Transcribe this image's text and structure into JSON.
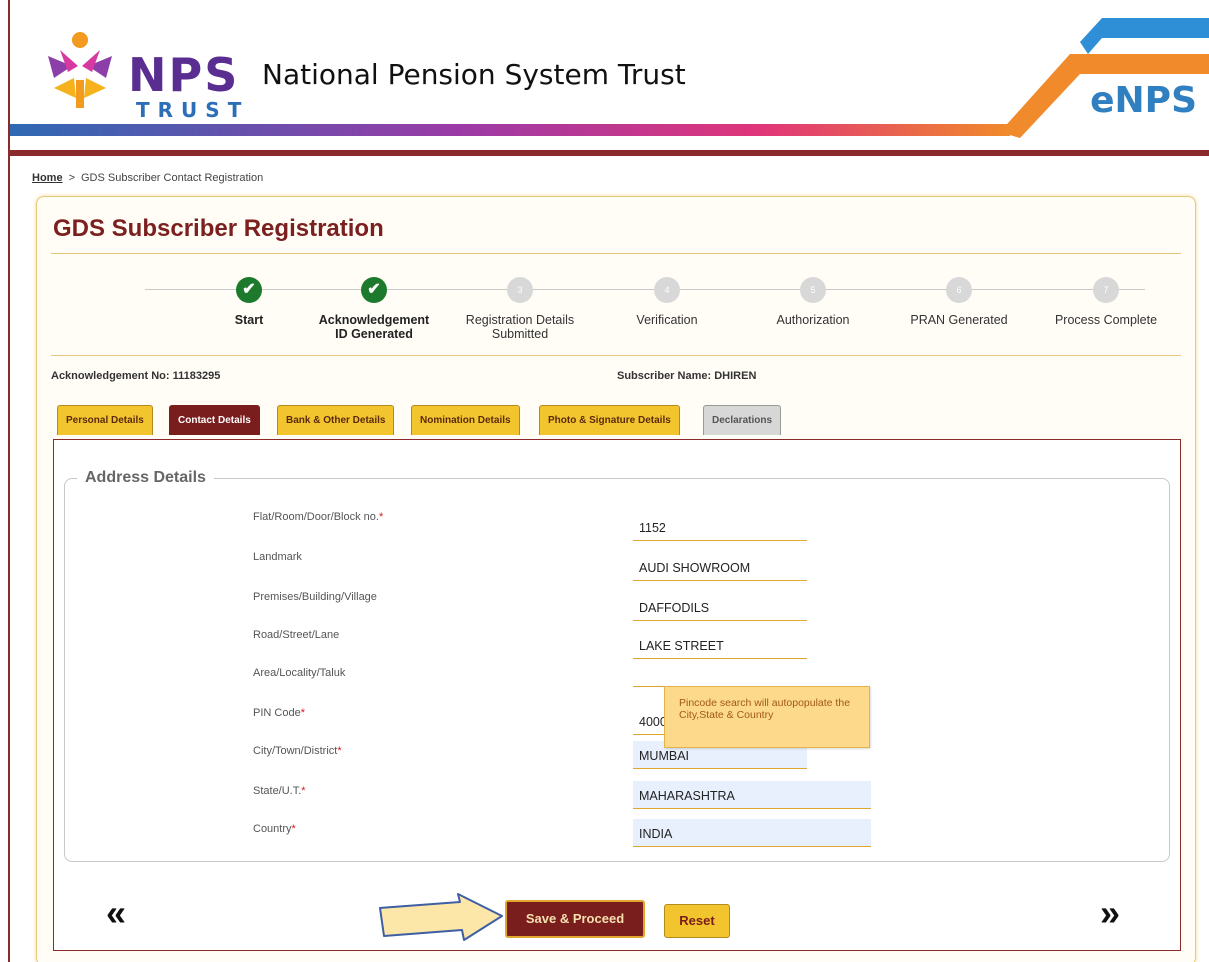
{
  "header": {
    "logo_main": "NPS",
    "logo_sub": "TRUST",
    "org_title": "National Pension System Trust",
    "badge": "eNPS"
  },
  "breadcrumb": {
    "home": "Home",
    "separator": ">",
    "current": "GDS Subscriber Contact Registration"
  },
  "page": {
    "title": "GDS Subscriber Registration",
    "ack_label": "Acknowledgement No:",
    "ack_value": "11183295",
    "subscriber_label": "Subscriber Name:",
    "subscriber_value": "DHIREN"
  },
  "steps": [
    {
      "num": "✔",
      "label1": "Start",
      "label2": "",
      "done": true
    },
    {
      "num": "✔",
      "label1": "Acknowledgement",
      "label2": "ID Generated",
      "done": true
    },
    {
      "num": "3",
      "label1": "Registration Details",
      "label2": "Submitted",
      "done": false
    },
    {
      "num": "4",
      "label1": "Verification",
      "label2": "",
      "done": false
    },
    {
      "num": "5",
      "label1": "Authorization",
      "label2": "",
      "done": false
    },
    {
      "num": "6",
      "label1": "PRAN Generated",
      "label2": "",
      "done": false
    },
    {
      "num": "7",
      "label1": "Process Complete",
      "label2": "",
      "done": false
    }
  ],
  "tabs": [
    {
      "label": "Personal Details",
      "state": "normal"
    },
    {
      "label": "Contact Details",
      "state": "active"
    },
    {
      "label": "Bank & Other Details",
      "state": "normal"
    },
    {
      "label": "Nomination Details",
      "state": "normal"
    },
    {
      "label": "Photo & Signature Details",
      "state": "normal"
    },
    {
      "label": "Declarations",
      "state": "disabled"
    }
  ],
  "address": {
    "legend": "Address Details",
    "fields": [
      {
        "label": "Flat/Room/Door/Block no.",
        "required": true,
        "value": "1152"
      },
      {
        "label": "Landmark",
        "required": false,
        "value": "AUDI SHOWROOM"
      },
      {
        "label": "Premises/Building/Village",
        "required": false,
        "value": "DAFFODILS"
      },
      {
        "label": "Road/Street/Lane",
        "required": false,
        "value": "LAKE STREET"
      },
      {
        "label": "Area/Locality/Taluk",
        "required": false,
        "value": ""
      },
      {
        "label": "PIN Code",
        "required": true,
        "value": "40000"
      },
      {
        "label": "City/Town/District",
        "required": true,
        "value": "MUMBAI"
      },
      {
        "label": "State/U.T.",
        "required": true,
        "value": "MAHARASHTRA"
      },
      {
        "label": "Country",
        "required": true,
        "value": "INDIA"
      }
    ],
    "tooltip": "Pincode search will autopopulate the City,State & Country"
  },
  "buttons": {
    "save": "Save & Proceed",
    "reset": "Reset",
    "prev": "«",
    "next": "»"
  },
  "colors": {
    "maroon": "#7a1d1d",
    "gold": "#f2c52e",
    "green": "#1d7a2c"
  }
}
